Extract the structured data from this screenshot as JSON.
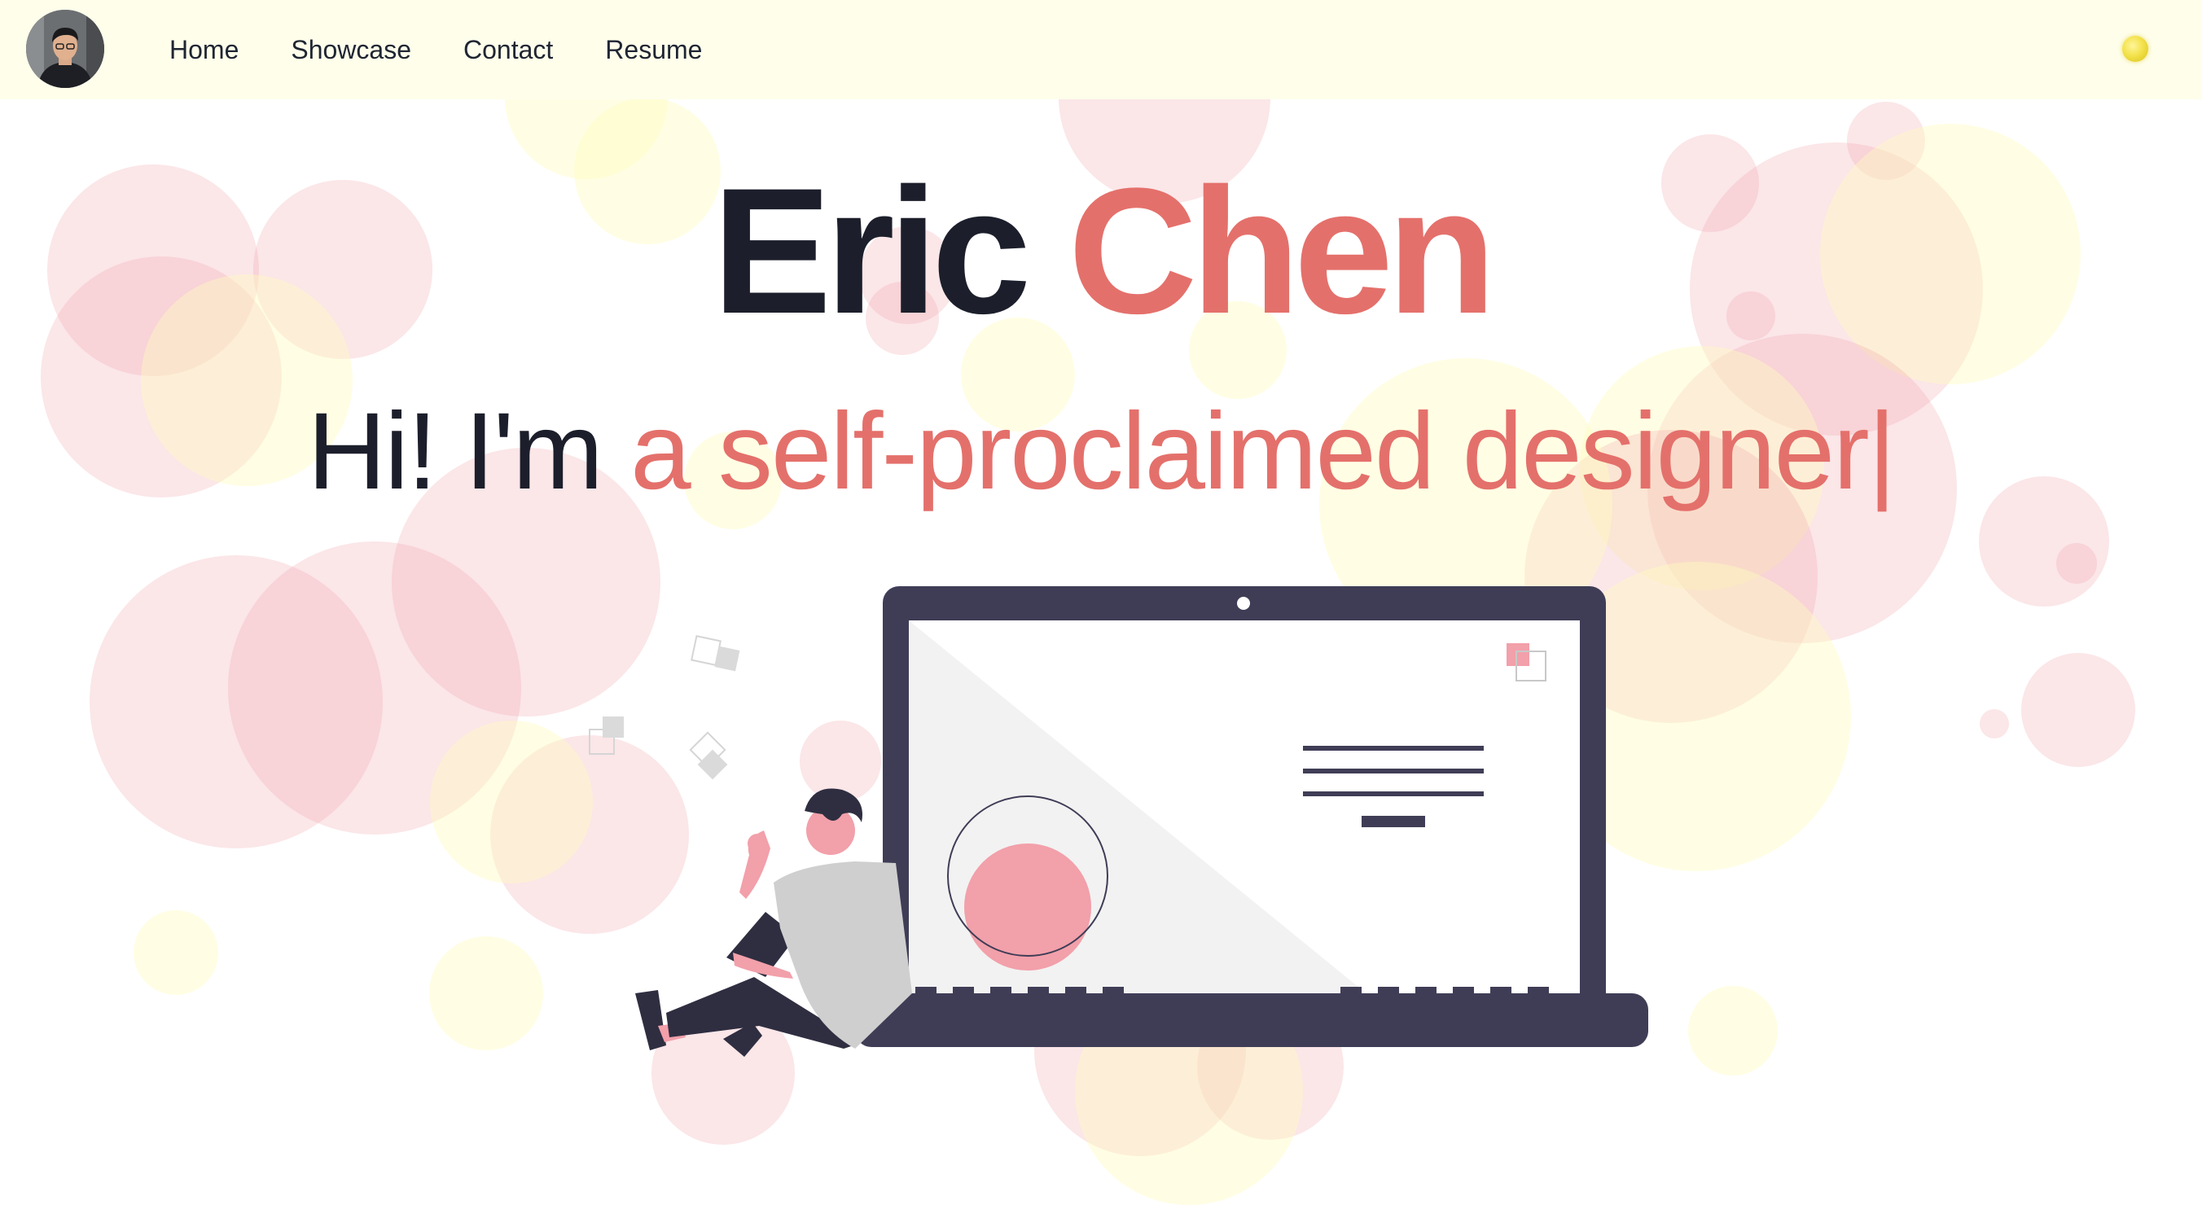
{
  "nav": {
    "avatar_alt": "Eric Chen avatar",
    "links": [
      {
        "label": "Home"
      },
      {
        "label": "Showcase"
      },
      {
        "label": "Contact"
      },
      {
        "label": "Resume"
      }
    ],
    "theme_toggle": {
      "icon": "sun-icon",
      "color": "#f3e24c"
    }
  },
  "hero": {
    "first_name": "Eric",
    "last_name": "Chen",
    "tagline_lead": "Hi! I'm ",
    "tagline_role": "a self-proclaimed designer",
    "cursor": "|"
  },
  "illustration": {
    "icon": "person-with-laptop-illustration"
  },
  "colors": {
    "accent": "#e4706b",
    "text_dark": "#1c1f2b",
    "nav_background": "#fefeeb",
    "laptop_frame": "#3f3d56",
    "bubble_pink": "#eea0a8",
    "bubble_yellow": "#fffcbe"
  }
}
